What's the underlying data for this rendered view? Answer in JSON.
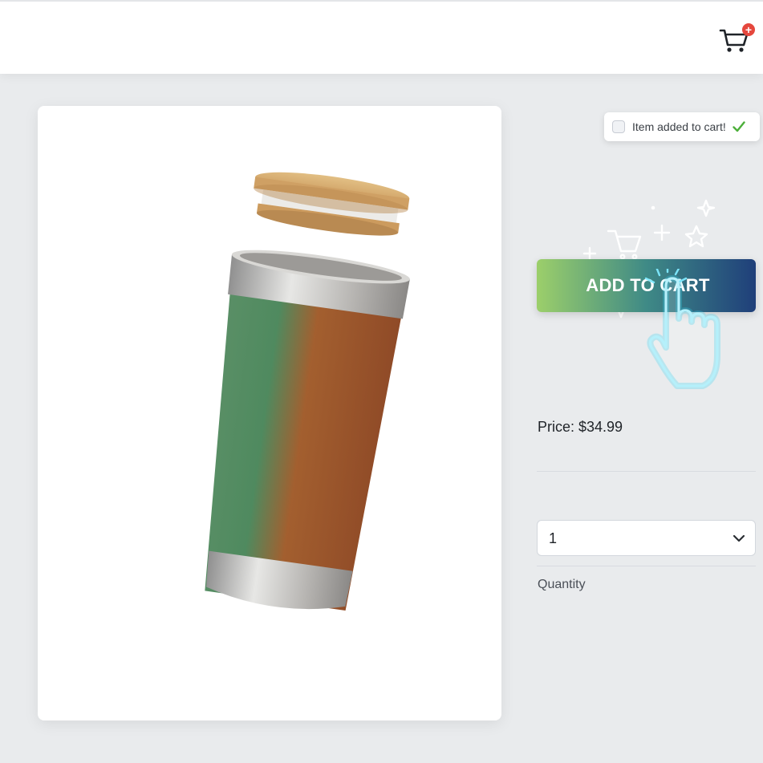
{
  "header": {
    "cart_badge": "+",
    "cart_icon": "shopping-cart-icon"
  },
  "product": {
    "image_icon": "tumbler-product-image"
  },
  "toast": {
    "message": "Item added to cart!",
    "check_icon": "checkmark-icon",
    "check_color": "#4caf3a"
  },
  "actions": {
    "add_to_cart_label": "ADD TO CART",
    "button_gradient": [
      "#9ccf6a",
      "#3f8a86",
      "#1f3f7a"
    ],
    "pointer_icon": "hand-pointer-icon",
    "sparkle_icon": "sparkle-cart-icon"
  },
  "pricing": {
    "price_text": "Price: $34.99"
  },
  "quantity": {
    "selected": "1",
    "label": "Quantity"
  },
  "colors": {
    "page_bg": "#e9ebed",
    "badge": "#e5473d",
    "accent": "#22c7e8"
  }
}
